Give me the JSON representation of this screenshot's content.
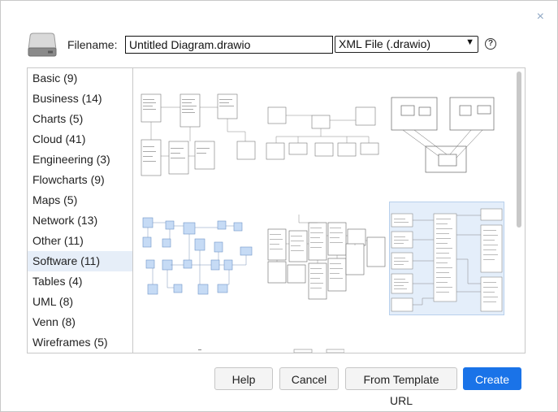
{
  "header": {
    "filename_label": "Filename:",
    "filename_value": "Untitled Diagram.drawio",
    "format_selected": "XML File (.drawio)",
    "help_symbol": "?",
    "close_symbol": "×"
  },
  "categories": [
    {
      "label": "Basic (9)"
    },
    {
      "label": "Business (14)"
    },
    {
      "label": "Charts (5)"
    },
    {
      "label": "Cloud (41)"
    },
    {
      "label": "Engineering (3)"
    },
    {
      "label": "Flowcharts (9)"
    },
    {
      "label": "Maps (5)"
    },
    {
      "label": "Network (13)"
    },
    {
      "label": "Other (11)"
    },
    {
      "label": "Software (11)"
    },
    {
      "label": "Tables (4)"
    },
    {
      "label": "UML (8)"
    },
    {
      "label": "Venn (8)"
    },
    {
      "label": "Wireframes (5)"
    }
  ],
  "selected_category": "Software (11)",
  "buttons": {
    "help": "Help",
    "cancel": "Cancel",
    "template_url": "From Template URL",
    "create": "Create"
  },
  "colors": {
    "accent": "#1a73e8",
    "selected_bg": "#e6eef8",
    "thumb_blue": "#c6dbf5"
  }
}
